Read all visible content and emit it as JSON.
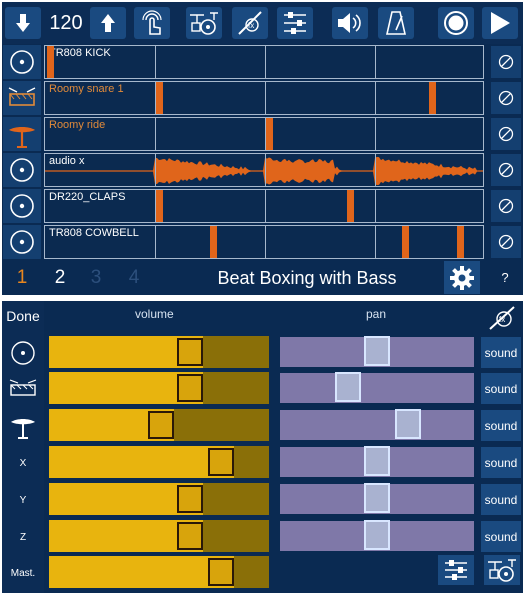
{
  "toolbar": {
    "tempo": "120",
    "icons": [
      "tempo-down-icon",
      "tempo-up-icon",
      "tap-icon",
      "drum-kit-icon",
      "fx-icon",
      "mixer-icon",
      "speaker-icon",
      "metronome-icon",
      "record-icon",
      "play-icon"
    ]
  },
  "tracks": [
    {
      "name": "TR808 KICK",
      "name_color": "white",
      "icon": "kick-icon"
    },
    {
      "name": "Roomy snare 1",
      "name_color": "orange",
      "icon": "snare-icon"
    },
    {
      "name": "Roomy ride",
      "name_color": "orange",
      "icon": "cymbal-icon"
    },
    {
      "name": "audio x",
      "name_color": "white",
      "icon": "audio-icon"
    },
    {
      "name": "DR220_CLAPS",
      "name_color": "white",
      "icon": "claps-icon"
    },
    {
      "name": "TR808 COWBELL",
      "name_color": "white",
      "icon": "cowbell-icon"
    }
  ],
  "pattern_pages": [
    "1",
    "2",
    "3",
    "4"
  ],
  "song_title": "Beat Boxing with Bass",
  "help_label": "?",
  "mixer": {
    "done_label": "Done",
    "volume_header": "volume",
    "pan_header": "pan",
    "sound_label": "sound",
    "channel_labels": [
      "",
      "",
      "",
      "X",
      "Y",
      "Z",
      "Mast."
    ],
    "volume_levels": [
      0.64,
      0.64,
      0.51,
      0.78,
      0.64,
      0.64,
      0.78
    ],
    "pan_positions": [
      0.5,
      0.35,
      0.66,
      0.5,
      0.5,
      0.5
    ]
  },
  "colors": {
    "accent_orange": "#e0651b",
    "volume_yellow": "#e8b40e",
    "pan_purple": "#7f78a8",
    "panel_blue": "#0a2a52"
  }
}
